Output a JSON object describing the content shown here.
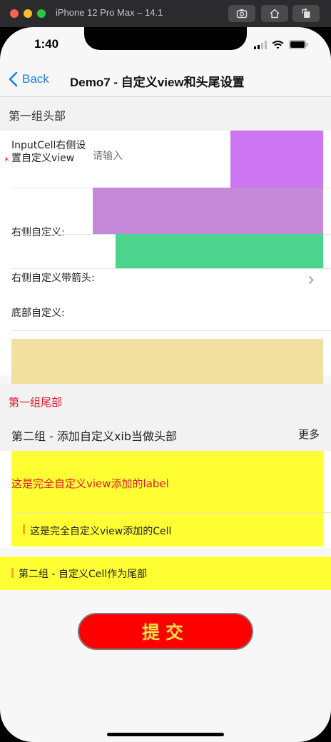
{
  "simulator": {
    "title": "iPhone 12 Pro Max – 14.1",
    "buttons": [
      "screenshot-icon",
      "home-icon",
      "rotate-icon"
    ]
  },
  "status_bar": {
    "time": "1:40",
    "icons": [
      "signal-icon",
      "wifi-icon",
      "battery-icon"
    ]
  },
  "nav": {
    "back_label": "Back",
    "title": "Demo7 - 自定义view和头尾设置"
  },
  "section1": {
    "header": "第一组头部",
    "input_cell": {
      "required_mark": "*",
      "label": "InputCell右侧设置自定义view",
      "placeholder": "请输入",
      "right_view_color": "#cc77f1"
    },
    "right_custom": {
      "label": "右侧自定义:",
      "view_color": "#c489d8"
    },
    "right_custom_arrow": {
      "label": "右侧自定义带箭头:",
      "view_color": "#4cd38e"
    },
    "bottom_custom": {
      "label": "底部自定义:",
      "view_color": "#f2e0a0"
    },
    "footer": "第一组尾部"
  },
  "section2": {
    "header": "第二组 - 添加自定义xib当做头部",
    "more": "更多",
    "custom_label": "这是完全自定义view添加的label",
    "custom_cell": "这是完全自定义view添加的Cell",
    "footer_cell": "第二组 - 自定义Cell作为尾部"
  },
  "submit": {
    "label": "提交"
  },
  "colors": {
    "accent": "#1a7ee6",
    "footer_red": "#e2182e",
    "yellow": "#ffff33",
    "submit_bg": "#fe0000",
    "submit_text": "#f7e24a"
  }
}
